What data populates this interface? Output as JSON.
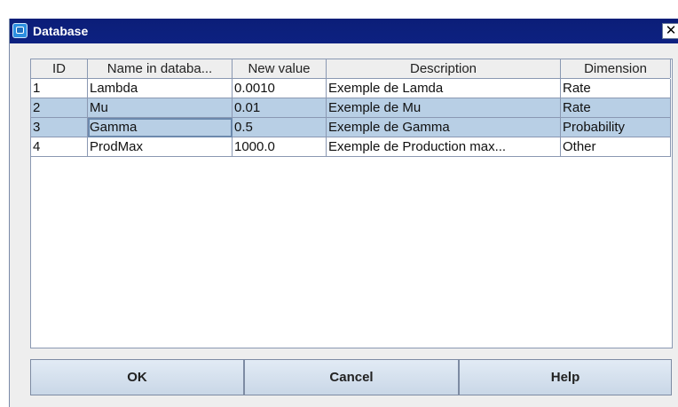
{
  "window": {
    "title": "Database",
    "close_glyph": "✕"
  },
  "table": {
    "columns": [
      "ID",
      "Name in databa...",
      "New value",
      "Description",
      "Dimension"
    ],
    "rows": [
      {
        "id": "1",
        "name": "Lambda",
        "value": "0.0010",
        "description": "Exemple de Lamda",
        "dimension": "Rate",
        "selected": false
      },
      {
        "id": "2",
        "name": "Mu",
        "value": "0.01",
        "description": "Exemple de Mu",
        "dimension": "Rate",
        "selected": true
      },
      {
        "id": "3",
        "name": "Gamma",
        "value": "0.5",
        "description": "Exemple de Gamma",
        "dimension": "Probability",
        "selected": true
      },
      {
        "id": "4",
        "name": "ProdMax",
        "value": "1000.0",
        "description": "Exemple de Production max...",
        "dimension": "Other",
        "selected": false
      }
    ]
  },
  "buttons": {
    "ok": "OK",
    "cancel": "Cancel",
    "help": "Help"
  },
  "colors": {
    "titlebar": "#0d2181",
    "selection": "#b8cfe5",
    "dialog_bg": "#eeeeee"
  }
}
